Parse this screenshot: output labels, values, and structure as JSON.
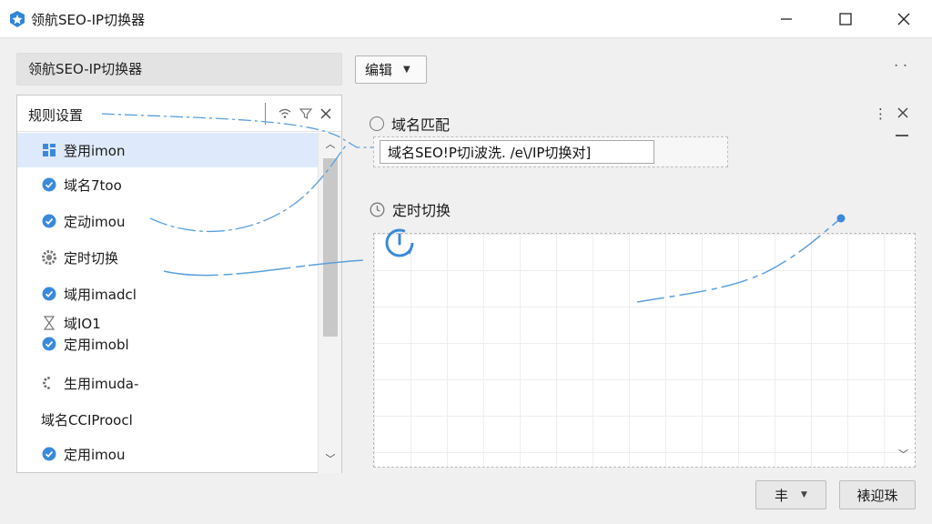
{
  "window": {
    "title": "领航SEO-IP切换器",
    "controls": [
      "minimize-icon",
      "maximize-icon",
      "close-icon"
    ]
  },
  "toolbar": {
    "app_name": "领航SEO-IP切换器",
    "edit_label": "编辑",
    "more_label": "⠂⠂"
  },
  "rules_panel": {
    "title": "规则设置",
    "tools": [
      "wifi-icon",
      "filter-icon",
      "close-icon"
    ],
    "items": [
      {
        "label": "登用imon",
        "icon": "grid-icon",
        "selected": true
      },
      {
        "label": "域名7too",
        "icon": "check-circle-icon"
      },
      {
        "label": "定动imou",
        "icon": "check-circle-icon"
      },
      {
        "label": "定时切换",
        "icon": "gear-icon"
      },
      {
        "label": "域用imadcl",
        "icon": "check-circle-icon"
      },
      {
        "label": "域IO1",
        "icon": "hourglass-icon"
      },
      {
        "label": "定用imobl",
        "icon": "check-circle-icon"
      },
      {
        "label": "生用imuda-",
        "icon": "gear-half-icon"
      },
      {
        "label": "域名CCIProocl",
        "icon": ""
      },
      {
        "label": "定用imou",
        "icon": "check-circle-icon"
      }
    ]
  },
  "right_panel": {
    "domain_match_label": "域名匹配",
    "domain_value": "域名SEO!P切i波洗. /e\\/IP切换对]",
    "timer_label": "定时切换",
    "more_label": "⋮"
  },
  "footer": {
    "dropdown_label": "丰",
    "confirm_label": "裱迎珠"
  },
  "colors": {
    "accent": "#3b8ad9",
    "selected_row": "#deeafb",
    "line": "#5b9fdc"
  }
}
